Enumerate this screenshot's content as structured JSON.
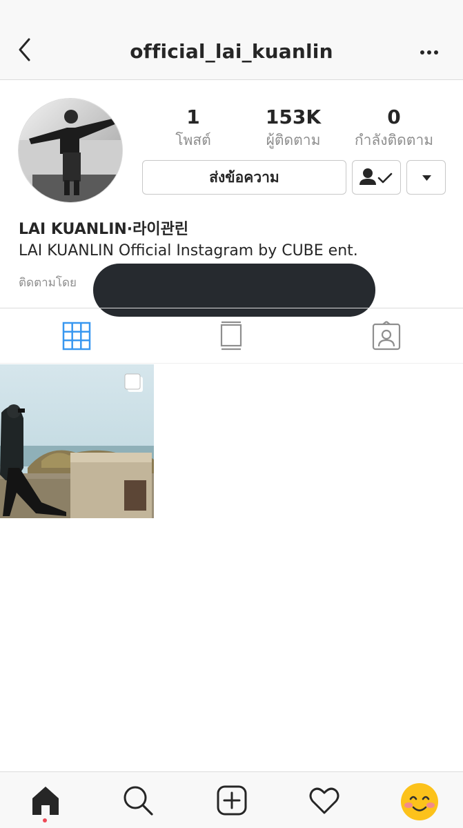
{
  "header": {
    "username": "official_lai_kuanlin"
  },
  "profile": {
    "stats": [
      {
        "value": "1",
        "label": "โพสต์"
      },
      {
        "value": "153K",
        "label": "ผู้ติดตาม"
      },
      {
        "value": "0",
        "label": "กำลังติดตาม"
      }
    ],
    "message_button": "ส่งข้อความ",
    "display_name": "LAI KUANLIN·라이관린",
    "bio": "LAI KUANLIN Official Instagram by CUBE ent.",
    "followed_by_prefix": "ติดตามโดย"
  },
  "icons": {
    "back": "chevron-left-icon",
    "more": "more-horizontal-icon",
    "following": "person-check-icon",
    "dropdown": "caret-down-icon",
    "tab_grid": "grid-icon",
    "tab_feed": "feed-icon",
    "tab_tagged": "tagged-icon",
    "multi": "carousel-icon",
    "home": "home-icon",
    "search": "search-icon",
    "add": "add-icon",
    "activity": "heart-icon",
    "profile": "smiley-avatar-icon"
  },
  "colors": {
    "active_tab": "#3897f0",
    "text": "#262626",
    "muted": "#8e8e8e",
    "notification_dot": "#ed4956"
  }
}
